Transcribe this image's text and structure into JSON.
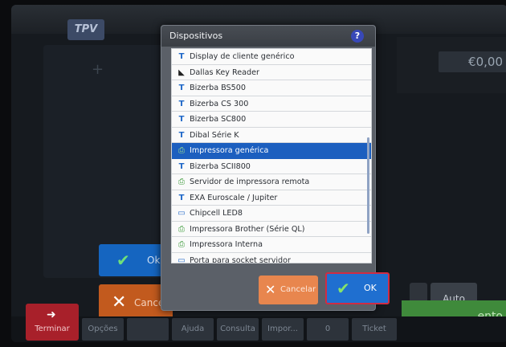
{
  "dialog": {
    "title": "Dispositivos",
    "help_label": "?",
    "cancel_label": "Cancelar",
    "ok_label": "OK",
    "selected_index": 6,
    "items": [
      {
        "label": "Display de cliente genérico",
        "icon": "scale-icon"
      },
      {
        "label": "Dallas Key Reader",
        "icon": "key-icon"
      },
      {
        "label": "Bizerba BS500",
        "icon": "scale-icon"
      },
      {
        "label": "Bizerba CS 300",
        "icon": "scale-icon"
      },
      {
        "label": "Bizerba SC800",
        "icon": "scale-icon"
      },
      {
        "label": "Dibal Série K",
        "icon": "scale-icon"
      },
      {
        "label": "Impressora genérica",
        "icon": "printer-icon"
      },
      {
        "label": "Bizerba SCII800",
        "icon": "scale-icon"
      },
      {
        "label": "Servidor de impressora remota",
        "icon": "printer-icon"
      },
      {
        "label": "EXA Euroscale / Jupiter",
        "icon": "scale-icon"
      },
      {
        "label": "Chipcell LED8",
        "icon": "monitor-icon"
      },
      {
        "label": "Impressora Brother (Série QL)",
        "icon": "printer-icon"
      },
      {
        "label": "Impressora Interna",
        "icon": "printer-icon"
      },
      {
        "label": "Porta para socket servidor",
        "icon": "monitor-icon"
      }
    ]
  },
  "background": {
    "logo": "TPV",
    "amount": "€0,00",
    "ok_label": "Ok",
    "cancel_label": "Cancelar",
    "auto_label": "Auto",
    "terminate_label": "Terminar",
    "green_label": "ento",
    "bottom_tabs": [
      "Opções",
      "",
      "Ajuda",
      "Consulta",
      "Impor...",
      "0",
      "Ticket"
    ]
  },
  "colors": {
    "selection": "#1c5fbf",
    "ok_button": "#1f6fd0",
    "cancel_button": "#e8864e",
    "terminate_button": "#a8202a"
  }
}
